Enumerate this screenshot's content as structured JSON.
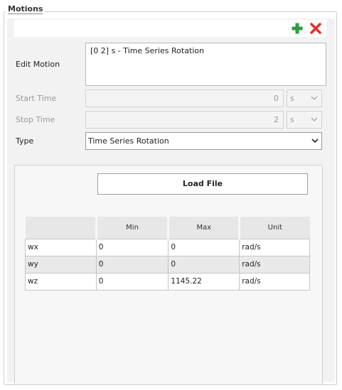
{
  "group": {
    "title": "Motions"
  },
  "toolbar": {
    "add_icon": "plus-icon",
    "delete_icon": "close-icon",
    "add_color": "#2e9a44",
    "delete_color": "#e03131"
  },
  "form": {
    "edit_motion_label": "Edit Motion",
    "edit_motion_value": "[0 2] s - Time Series Rotation",
    "start_time_label": "Start Time",
    "start_time_value": "0",
    "start_time_unit": "s",
    "stop_time_label": "Stop Time",
    "stop_time_value": "2",
    "stop_time_unit": "s",
    "type_label": "Type",
    "type_value": "Time Series Rotation"
  },
  "load_file": {
    "label": "Load File"
  },
  "table": {
    "headers": [
      "",
      "Min",
      "Max",
      "Unit"
    ],
    "rows": [
      [
        "wx",
        "0",
        "0",
        "rad/s"
      ],
      [
        "wy",
        "0",
        "0",
        "rad/s"
      ],
      [
        "wz",
        "0",
        "1145.22",
        "rad/s"
      ]
    ]
  }
}
